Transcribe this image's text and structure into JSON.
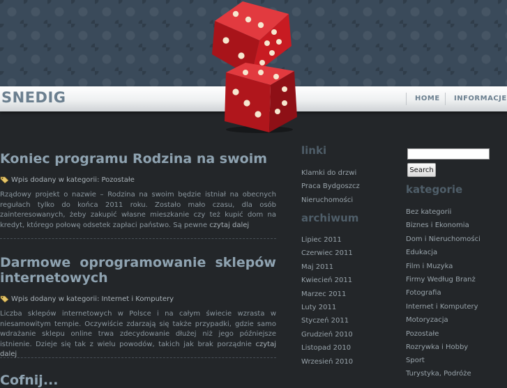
{
  "site": {
    "logo": "SNEDIG"
  },
  "nav": {
    "home": "HOME",
    "info": "INFORMACJE"
  },
  "posts": [
    {
      "title": "Koniec programu Rodzina na swoim",
      "meta_prefix": "Wpis dodany w kategorii:",
      "category": "Pozostałe",
      "excerpt": "Rządowy projekt o nazwie – Rodzina na swoim będzie istniał na obecnych regułach tylko do końca 2011 roku. Zostało mało czasu, dla osób zainteresowanych, żeby zakupić własne mieszkanie czy też kupić dom na kredyt, którego połowę odsetek zapłaci państwo. Są pewne",
      "more": "czytaj dalej"
    },
    {
      "title": "Darmowe oprogramowanie sklepów internetowych",
      "meta_prefix": "Wpis dodany w kategorii:",
      "category": "Internet i Komputery",
      "excerpt": "Liczba sklepów internetowych w Polsce i na całym świecie wzrasta w niesamowitym tempie. Oczywiście zdarzają się także przypadki, gdzie samo wdrażanie sklepu online trwa zdecydowanie dłużej niż jego późniejsze istnienie. Dzieje się tak z wielu powodów, takich jak brak porządnie",
      "more": "czytaj dalej"
    },
    {
      "title": "Cofnij..."
    }
  ],
  "sidebar": {
    "links_heading": "linki",
    "links": [
      "Klamki do drzwi",
      "Praca Bydgoszcz",
      "Nieruchomości"
    ],
    "archive_heading": "archiwum",
    "archive": [
      "Lipiec 2011",
      "Czerwiec 2011",
      "Maj 2011",
      "Kwiecień 2011",
      "Marzec 2011",
      "Luty 2011",
      "Styczeń 2011",
      "Grudzień 2010",
      "Listopad 2010",
      "Wrzesień 2010"
    ],
    "search_button": "Search",
    "search_value": "",
    "categories_heading": "kategorie",
    "categories": [
      "Bez kategorii",
      "Biznes i Ekonomia",
      "Dom i Nieruchomości",
      "Edukacja",
      "Film i Muzyka",
      "Firmy Według Branż",
      "Fotografia",
      "Internet i Komputery",
      "Motoryzacja",
      "Pozostałe",
      "Rozrywka i Hobby",
      "Sport",
      "Turystyka, Podróże"
    ]
  },
  "colors": {
    "background": "#232629",
    "title": "#8fa3b1",
    "header_pattern": "#3a4a5a",
    "dice": "#c0151b"
  },
  "icons": {
    "category": "tag-icon",
    "logo_art": "dice-icon"
  }
}
